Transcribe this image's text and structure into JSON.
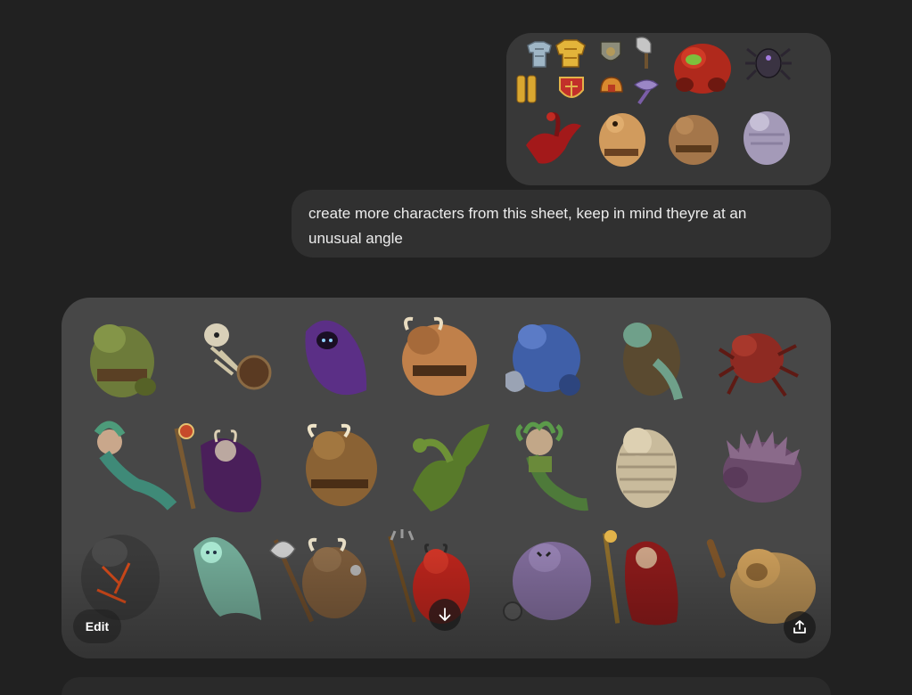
{
  "conversation": {
    "user_message": "create more characters from this sheet, keep in mind theyre at an unusual angle"
  },
  "attachment": {
    "items": [
      "steel-armor",
      "gold-armor",
      "shield",
      "axe",
      "red-demon",
      "spider",
      "gold-legs",
      "red-shield",
      "helmet",
      "double-axe",
      "red-dragon",
      "cyclops",
      "giant",
      "ghoul"
    ]
  },
  "generated_image": {
    "characters": [
      "orc",
      "skeleton-warrior",
      "hooded-wraith",
      "minotaur",
      "armored-knight",
      "zombie",
      "giant-spider",
      "mermaid",
      "horned-warlock",
      "minotaur-brown",
      "green-dragon",
      "medusa",
      "mummy",
      "spiked-beast",
      "lava-golem",
      "ghost",
      "minotaur-axe",
      "red-devil",
      "purple-ogre",
      "red-sorceress",
      "lion-beast"
    ],
    "edit_label": "Edit",
    "download_icon": "arrow-down-icon",
    "share_icon": "share-icon"
  }
}
